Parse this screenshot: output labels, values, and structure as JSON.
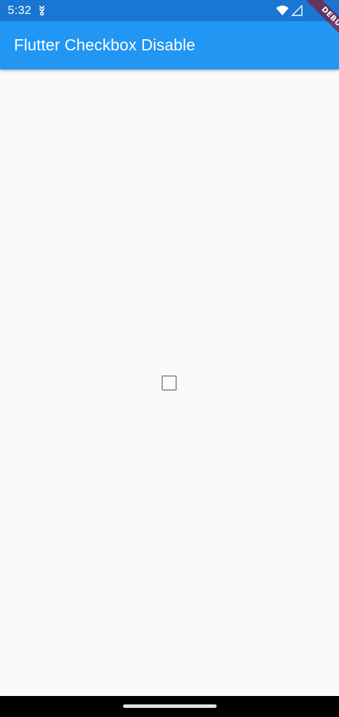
{
  "status_bar": {
    "time": "5:32",
    "icons": [
      "download-icon",
      "wifi-icon",
      "signal-icon"
    ],
    "background": "#1976d2"
  },
  "app_bar": {
    "title": "Flutter Checkbox Disable",
    "background": "#2196f3",
    "title_color": "#ffffff"
  },
  "debug_banner": {
    "label": "DEBUG"
  },
  "checkbox": {
    "checked": false,
    "disabled": true,
    "border_color": "#9e9e9e"
  },
  "navigation_bar": {
    "background": "#000000",
    "indicator_color": "#e0e0e0"
  }
}
